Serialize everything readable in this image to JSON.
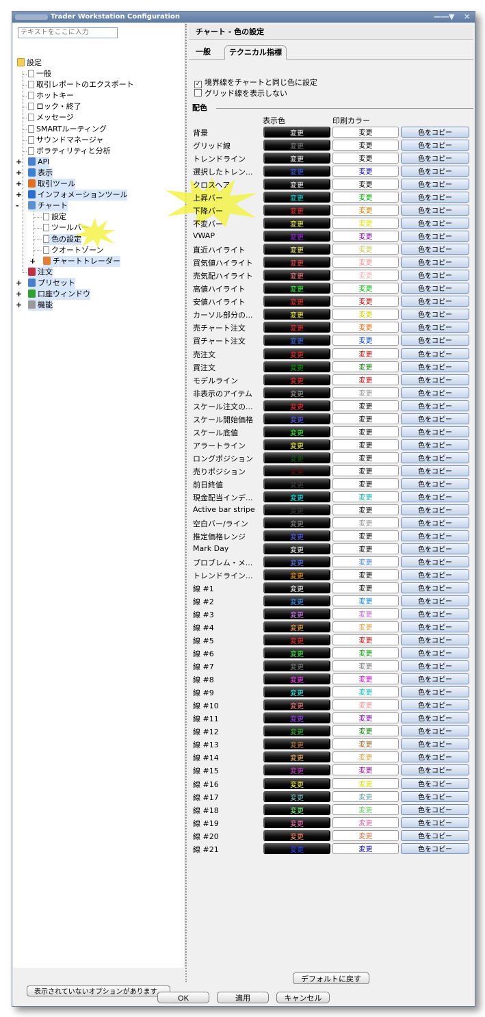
{
  "window": {
    "title": "Trader Workstation Configuration",
    "pin": "—―▼",
    "close": "✕"
  },
  "search": {
    "placeholder": "テキストをここに入力"
  },
  "tree": {
    "root": "設定",
    "items": [
      {
        "label": "一般"
      },
      {
        "label": "取引レポートのエクスポート"
      },
      {
        "label": "ホットキー"
      },
      {
        "label": "ロック・終了"
      },
      {
        "label": "メッセージ"
      },
      {
        "label": "SMARTルーティング"
      },
      {
        "label": "サウンドマネージャ"
      },
      {
        "label": "ボラティリティと分析"
      },
      {
        "label": "API"
      },
      {
        "label": "表示"
      },
      {
        "label": "取引ツール"
      },
      {
        "label": "インフォメーションツール"
      },
      {
        "label": "チャート"
      },
      {
        "label": "設定"
      },
      {
        "label": "ツールバー"
      },
      {
        "label": "色の設定"
      },
      {
        "label": "クオートゾーン"
      },
      {
        "label": "チャートトレーダー"
      },
      {
        "label": "注文"
      },
      {
        "label": "プリセット"
      },
      {
        "label": "口座ウィンドウ"
      },
      {
        "label": "機能"
      }
    ]
  },
  "hidden_options_button": "表示されていないオプションがあります...",
  "panel": {
    "title": "チャート - 色の設定"
  },
  "tabs": [
    {
      "label": "一般"
    },
    {
      "label": "テクニカル指標"
    }
  ],
  "checkboxes": [
    {
      "label": "境界線をチャートと同じ色に設定",
      "checked": true,
      "mark": "✓"
    },
    {
      "label": "グリッド線を表示しない",
      "checked": false,
      "mark": ""
    }
  ],
  "section": {
    "title": "配色",
    "col_display": "表示色",
    "col_print": "印刷カラー"
  },
  "button_labels": {
    "change": "変更",
    "copy": "色をコピー"
  },
  "rows": [
    {
      "label": "背景",
      "display": "#ffffff",
      "print": "#000000"
    },
    {
      "label": "グリッド線",
      "display": "#808080",
      "print": "#000000"
    },
    {
      "label": "トレンドライン",
      "display": "#ffffff",
      "print": "#000000"
    },
    {
      "label": "選択したトレン...",
      "display": "#3a5cff",
      "print": "#0000cc"
    },
    {
      "label": "クロスヘア",
      "display": "#ffffff",
      "print": "#000000"
    },
    {
      "label": "上昇バー",
      "display": "#00e5e5",
      "print": "#00b000"
    },
    {
      "label": "下降バー",
      "display": "#ff3030",
      "print": "#e08000"
    },
    {
      "label": "不変バー",
      "display": "#ffff40",
      "print": "#e0e000"
    },
    {
      "label": "VWAP",
      "display": "#a020f0",
      "print": "#8000c0"
    },
    {
      "label": "直近ハイライト",
      "display": "#ffff80",
      "print": "#c8c850"
    },
    {
      "label": "買気値ハイライト",
      "display": "#ff5050",
      "print": "#ff9090"
    },
    {
      "label": "売気配ハイライト",
      "display": "#ff8080",
      "print": "#ffb0b0"
    },
    {
      "label": "高値ハイライト",
      "display": "#30ff30",
      "print": "#00c000"
    },
    {
      "label": "安値ハイライト",
      "display": "#ff3030",
      "print": "#d00000"
    },
    {
      "label": "カーソル部分の...",
      "display": "#ffff40",
      "print": "#d0d000"
    },
    {
      "label": "売チャート注文",
      "display": "#ff3030",
      "print": "#ff6000"
    },
    {
      "label": "買チャート注文",
      "display": "#3a6cff",
      "print": "#0040ff"
    },
    {
      "label": "売注文",
      "display": "#ff3030",
      "print": "#d00000"
    },
    {
      "label": "買注文",
      "display": "#00a000",
      "print": "#008000"
    },
    {
      "label": "モデルライン",
      "display": "#ff3030",
      "print": "#d00000"
    },
    {
      "label": "非表示のアイテム",
      "display": "#a0a0a0",
      "print": "#909090"
    },
    {
      "label": "スケール注文の...",
      "display": "#ff3030",
      "print": "#000000"
    },
    {
      "label": "スケール開始価格",
      "display": "#6060ff",
      "print": "#000000"
    },
    {
      "label": "スケール底値",
      "display": "#40ff40",
      "print": "#000000"
    },
    {
      "label": "アラートライン",
      "display": "#ffff40",
      "print": "#000000"
    },
    {
      "label": "ロングポジション",
      "display": "#106010",
      "print": "#000000"
    },
    {
      "label": "売りポジション",
      "display": "#601010",
      "print": "#000000"
    },
    {
      "label": "前日終値",
      "display": "#404040",
      "print": "#000000"
    },
    {
      "label": "現金配当インデ...",
      "display": "#00ffff",
      "print": "#00b0b0"
    },
    {
      "label": "Active bar stripe",
      "display": "#404040",
      "print": "#000000"
    },
    {
      "label": "空白バー/ライン",
      "display": "#909090",
      "print": "#909090"
    },
    {
      "label": "推定価格レンジ",
      "display": "#6060ff",
      "print": "#000000"
    },
    {
      "label": "Mark Day",
      "display": "#ffffff",
      "print": "#000000"
    },
    {
      "label": "プロブレム・メ...",
      "display": "#6080ff",
      "print": "#4080ff"
    },
    {
      "label": "トレンドライン...",
      "display": "#ffa000",
      "print": "#000000"
    },
    {
      "label": "線 #1",
      "display": "#ffffff",
      "print": "#000000"
    },
    {
      "label": "線 #2",
      "display": "#40a0ff",
      "print": "#0080ff"
    },
    {
      "label": "線 #3",
      "display": "#e080ff",
      "print": "#c060e0"
    },
    {
      "label": "線 #4",
      "display": "#ffb040",
      "print": "#e0a040"
    },
    {
      "label": "線 #5",
      "display": "#ff3030",
      "print": "#e00000"
    },
    {
      "label": "線 #6",
      "display": "#40ff40",
      "print": "#00a000"
    },
    {
      "label": "線 #7",
      "display": "#808080",
      "print": "#707070"
    },
    {
      "label": "線 #8",
      "display": "#ff40ff",
      "print": "#e000e0"
    },
    {
      "label": "線 #9",
      "display": "#40ffff",
      "print": "#00c0c0"
    },
    {
      "label": "線 #10",
      "display": "#ff8080",
      "print": "#ff9090"
    },
    {
      "label": "線 #11",
      "display": "#a040ff",
      "print": "#8000c0"
    },
    {
      "label": "線 #12",
      "display": "#30c030",
      "print": "#008000"
    },
    {
      "label": "線 #13",
      "display": "#c08040",
      "print": "#a06020"
    },
    {
      "label": "線 #14",
      "display": "#ffc060",
      "print": "#e0a040"
    },
    {
      "label": "線 #15",
      "display": "#d040d0",
      "print": "#a000a0"
    },
    {
      "label": "線 #16",
      "display": "#ffff40",
      "print": "#e0e000"
    },
    {
      "label": "線 #17",
      "display": "#80c0c0",
      "print": "#60a0a0"
    },
    {
      "label": "線 #18",
      "display": "#80ff80",
      "print": "#60d060"
    },
    {
      "label": "線 #19",
      "display": "#ff80c0",
      "print": "#e060a0"
    },
    {
      "label": "線 #20",
      "display": "#ff9060",
      "print": "#e07040"
    },
    {
      "label": "線 #21",
      "display": "#3040ff",
      "print": "#0000c0"
    }
  ],
  "default_button": "デフォルトに戻す",
  "footer": {
    "ok": "OK",
    "apply": "適用",
    "cancel": "キャンセル"
  }
}
